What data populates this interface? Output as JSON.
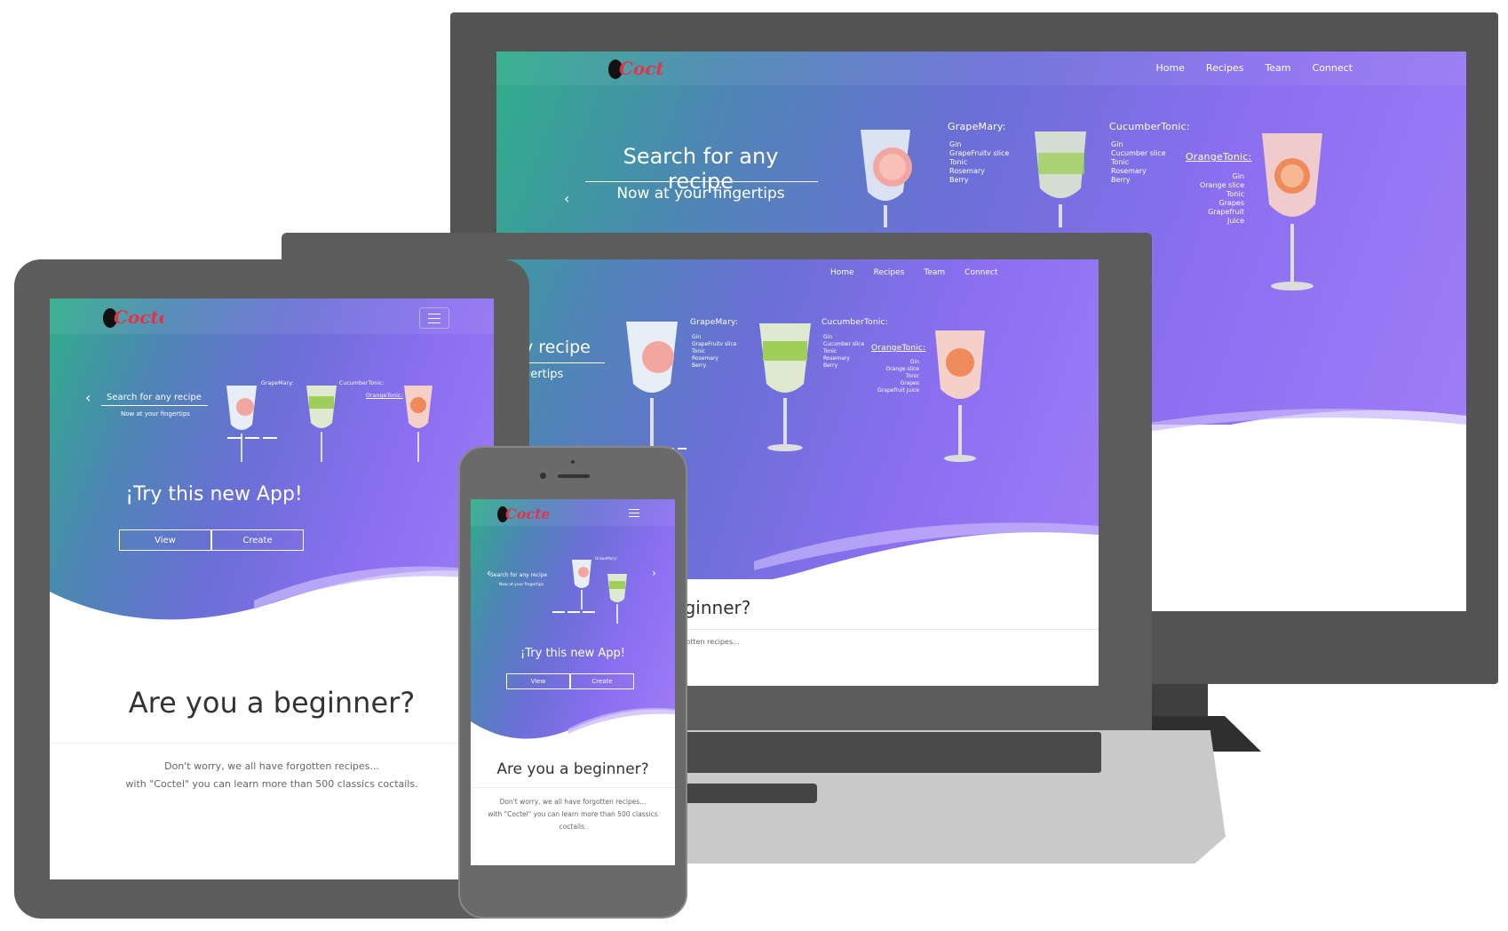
{
  "brand": {
    "logo_text": "Coctel"
  },
  "nav": {
    "items": [
      "Home",
      "Recipes",
      "Team",
      "Connect"
    ]
  },
  "hero": {
    "title": "Search for any recipe",
    "subtitle": "Now at your fingertips",
    "tablet_cta_title": "¡Try this new App!",
    "view_label": "View",
    "create_label": "Create"
  },
  "drinks": [
    {
      "name": "GrapeMary:",
      "ingredients": [
        "Gin",
        "GrapeFruitv slice",
        "Tonic",
        "Rosemary",
        "Berry"
      ]
    },
    {
      "name": "CucumberTonic:",
      "ingredients": [
        "Gin",
        "Cucumber slice",
        "Tonic",
        "Rosemary",
        "Berry"
      ]
    },
    {
      "name": "OrangeTonic:",
      "ingredients": [
        "Gin",
        "Orange slice",
        "Tonic",
        "Grapes",
        "Grapefruit Juice"
      ]
    }
  ],
  "laptop": {
    "hero_title_partial": "y recipe",
    "hero_subtitle_partial": "gertips",
    "beginner_partial": "a beginner?",
    "body_partial": "e all have forgotten recipes..."
  },
  "section": {
    "heading": "Are you a beginner?",
    "line1": "Don't worry, we all have forgotten recipes...",
    "line2": "with \"Coctel\" you can learn more than 500 classics coctails.",
    "phone_line2": "with \"Coctel\" you can learn more than 500 classics",
    "phone_line3": "coctails."
  },
  "colors": {
    "gradient_start": "#2fae8a",
    "gradient_end": "#a07cf6",
    "frame": "#5f5f5f",
    "logo": "#e0344a"
  }
}
